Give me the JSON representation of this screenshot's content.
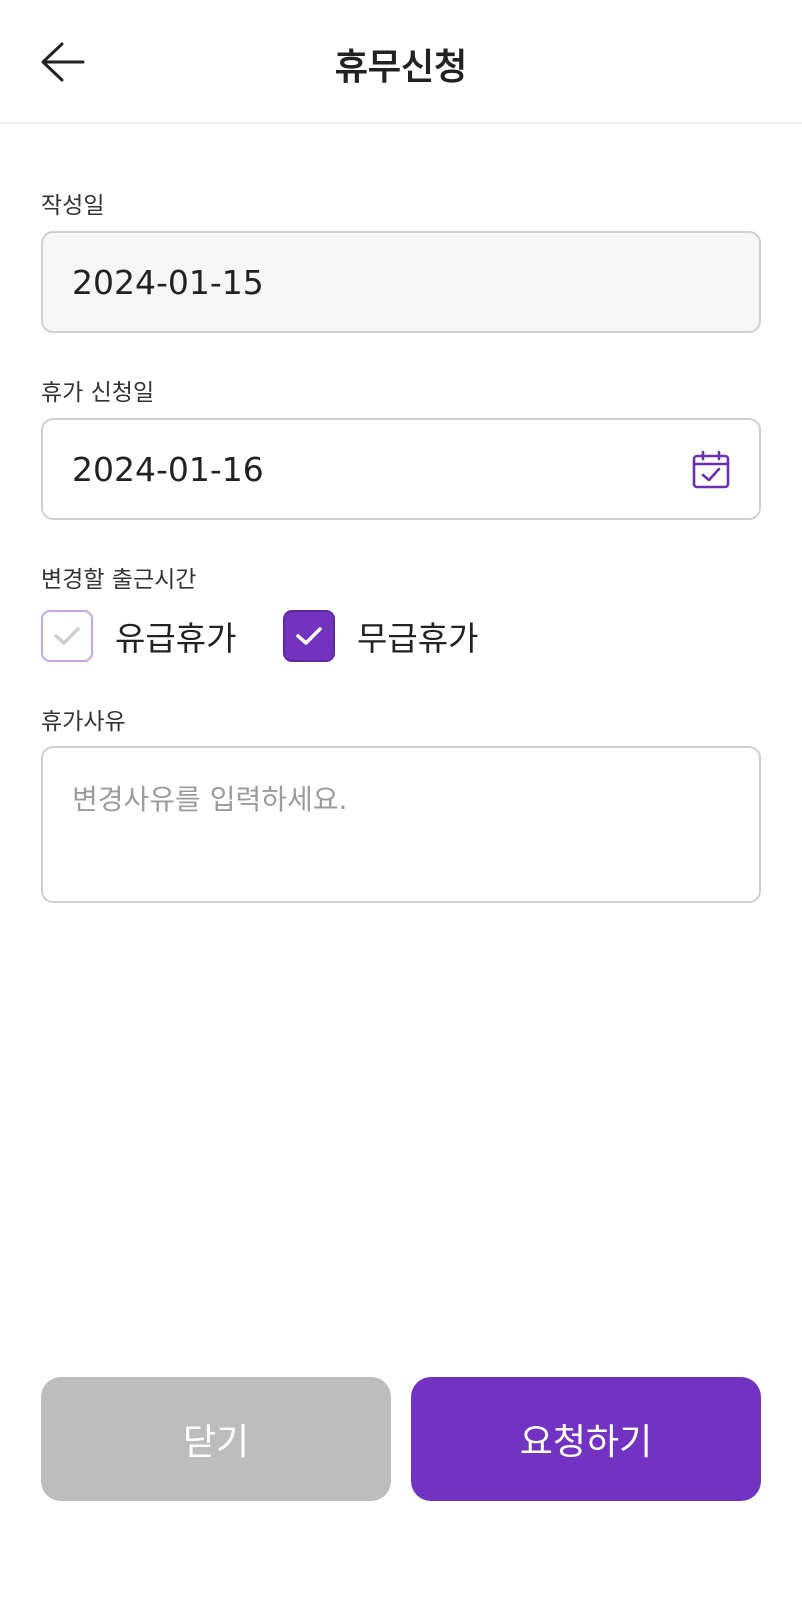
{
  "header": {
    "title": "휴무신청",
    "back_icon": "arrow-left-icon"
  },
  "form": {
    "written_date": {
      "label": "작성일",
      "value": "2024-01-15"
    },
    "leave_date": {
      "label": "휴가 신청일",
      "value": "2024-01-16",
      "icon": "calendar-check-icon"
    },
    "leave_type": {
      "label": "변경할 출근시간",
      "options": [
        {
          "label": "유급휴가",
          "checked": false
        },
        {
          "label": "무급휴가",
          "checked": true
        }
      ]
    },
    "reason": {
      "label": "휴가사유",
      "value": "",
      "placeholder": "변경사유를 입력하세요."
    }
  },
  "actions": {
    "close_label": "닫기",
    "submit_label": "요청하기"
  },
  "colors": {
    "accent": "#7333c2",
    "accent_checkbox": "#7333be",
    "disabled_button": "#bdbdbd",
    "field_border": "#cfcfcf",
    "readonly_bg": "#f6f6f6",
    "unchecked_border": "#c9a6e5"
  }
}
